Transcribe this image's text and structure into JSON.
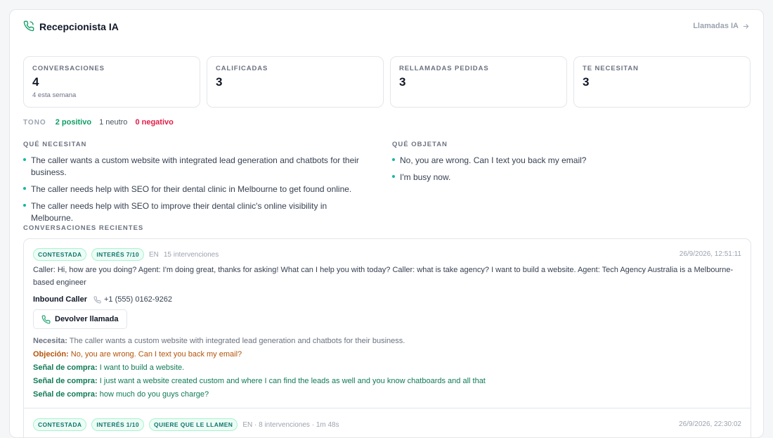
{
  "header": {
    "title": "Recepcionista IA",
    "link_label": "Llamadas IA"
  },
  "stats": [
    {
      "label": "CONVERSACIONES",
      "value": "4",
      "sub": "4 esta semana"
    },
    {
      "label": "CALIFICADAS",
      "value": "3"
    },
    {
      "label": "RELLAMADAS PEDIDAS",
      "value": "3"
    },
    {
      "label": "TE NECESITAN",
      "value": "3"
    }
  ],
  "tone": {
    "label": "TONO",
    "positive": "2 positivo",
    "neutral": "1 neutro",
    "negative": "0 negativo"
  },
  "needs": {
    "label": "QUÉ NECESITAN",
    "items": [
      "The caller wants a custom website with integrated lead generation and chatbots for their business.",
      "The caller needs help with SEO for their dental clinic in Melbourne to get found online.",
      "The caller needs help with SEO to improve their dental clinic's online visibility in Melbourne."
    ]
  },
  "objections": {
    "label": "QUÉ OBJETAN",
    "items": [
      "No, you are wrong. Can I text you back my email?",
      "I'm busy now."
    ]
  },
  "recent": {
    "label": "CONVERSACIONES RECIENTES",
    "first": {
      "badges": [
        "CONTESTADA",
        "INTERÉS 7/10"
      ],
      "lang": "EN",
      "turns": "15 intervenciones",
      "date": "26/9/2026, 12:51:11",
      "transcript": "Caller: Hi, how are you doing? Agent: I'm doing great, thanks for asking! What can I help you with today? Caller: what is take agency? I want to build a website. Agent: Tech Agency Australia is a Melbourne-based engineer",
      "caller_name": "Inbound Caller",
      "caller_phone": "+1 (555) 0162-9262",
      "callback_label": "Devolver llamada",
      "need_label": "Necesita:",
      "need_text": "The caller wants a custom website with integrated lead generation and chatbots for their business.",
      "objection_label": "Objeción:",
      "objection_text": "No, you are wrong. Can I text you back my email?",
      "signal_label": "Señal de compra:",
      "signals": [
        "I want to build a website.",
        "I just want a website created custom and where I can find the leads as well and you know chatboards and all that",
        "how much do you guys charge?"
      ]
    },
    "second": {
      "badges": [
        "CONTESTADA",
        "INTERÉS 1/10",
        "QUIERE QUE LE LLAMEN"
      ],
      "meta": "EN · 8 intervenciones · 1m 48s",
      "date": "26/9/2026, 22:30:02"
    }
  },
  "colors": {
    "accent": "#0f9d66",
    "negative": "#e11d48",
    "objection": "#b45309"
  }
}
